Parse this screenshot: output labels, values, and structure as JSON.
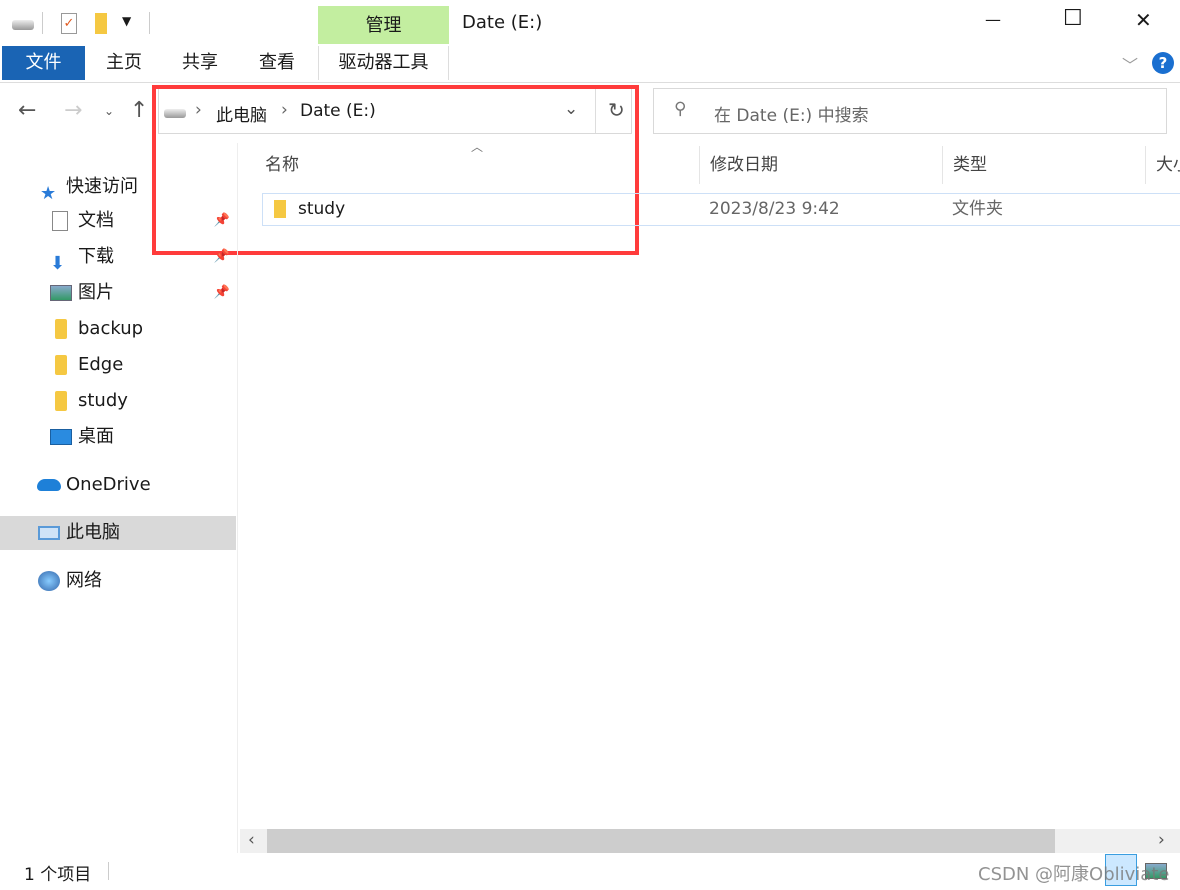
{
  "window": {
    "title": "Date (E:)",
    "context_tab_group": "管理",
    "minimize": "—",
    "maximize": "☐",
    "close": "✕"
  },
  "ribbon": {
    "tabs": [
      {
        "label": "文件"
      },
      {
        "label": "主页"
      },
      {
        "label": "共享"
      },
      {
        "label": "查看"
      },
      {
        "label": "驱动器工具"
      }
    ],
    "help": "?"
  },
  "address": {
    "crumbs": [
      "此电脑",
      "Date (E:)"
    ],
    "search_placeholder": "在 Date (E:) 中搜索"
  },
  "sidebar": {
    "quick_access": "快速访问",
    "items": [
      {
        "label": "文档",
        "pinned": true
      },
      {
        "label": "下载",
        "pinned": true
      },
      {
        "label": "图片",
        "pinned": true
      },
      {
        "label": "backup"
      },
      {
        "label": "Edge"
      },
      {
        "label": "study"
      },
      {
        "label": "桌面"
      }
    ],
    "onedrive": "OneDrive",
    "this_pc": "此电脑",
    "network": "网络"
  },
  "columns": [
    "名称",
    "修改日期",
    "类型",
    "大小"
  ],
  "files": [
    {
      "name": "study",
      "modified": "2023/8/23 9:42",
      "type": "文件夹"
    }
  ],
  "status": {
    "count": "1 个项目"
  },
  "watermark": "CSDN @阿康Obliviate",
  "colors": {
    "file_tab": "#1a64b4",
    "manage_tab": "#c3eea0",
    "highlight": "#ff3b3b",
    "selected": "#d9d9d9"
  }
}
